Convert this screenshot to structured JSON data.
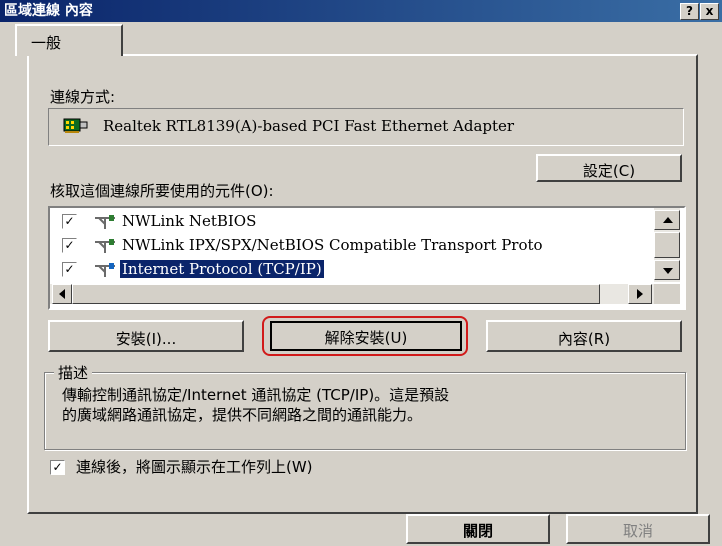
{
  "window": {
    "title": "區域連線 內容",
    "help_label": "?",
    "close_label": "x"
  },
  "tabs": [
    {
      "label": "一般"
    }
  ],
  "connect_using": {
    "label": "連線方式:",
    "adapter": "Realtek RTL8139(A)-based PCI Fast Ethernet Adapter",
    "configure_button": "設定(C)"
  },
  "components": {
    "label": "核取這個連線所要使用的元件(O):",
    "items": [
      {
        "label": "NWLink NetBIOS",
        "checked": true,
        "selected": false
      },
      {
        "label": "NWLink IPX/SPX/NetBIOS Compatible Transport Proto",
        "checked": true,
        "selected": false
      },
      {
        "label": "Internet Protocol (TCP/IP)",
        "checked": true,
        "selected": true
      }
    ],
    "check_mark": "✓"
  },
  "buttons": {
    "install": "安裝(I)...",
    "uninstall": "解除安裝(U)",
    "properties": "內容(R)"
  },
  "description": {
    "legend": "描述",
    "line1": "傳輸控制通訊協定/Internet 通訊協定 (TCP/IP)。這是預設",
    "line2": "的廣域網路通訊協定，提供不同網路之間的通訊能力。"
  },
  "show_icon": {
    "label": "連線後，將圖示顯示在工作列上(W)",
    "checked": true
  },
  "footer": {
    "close": "關閉",
    "cancel": "取消"
  },
  "colors": {
    "title_bar": "#0a246a",
    "face": "#d4d0c8",
    "highlight_ring": "#d11a1a"
  }
}
